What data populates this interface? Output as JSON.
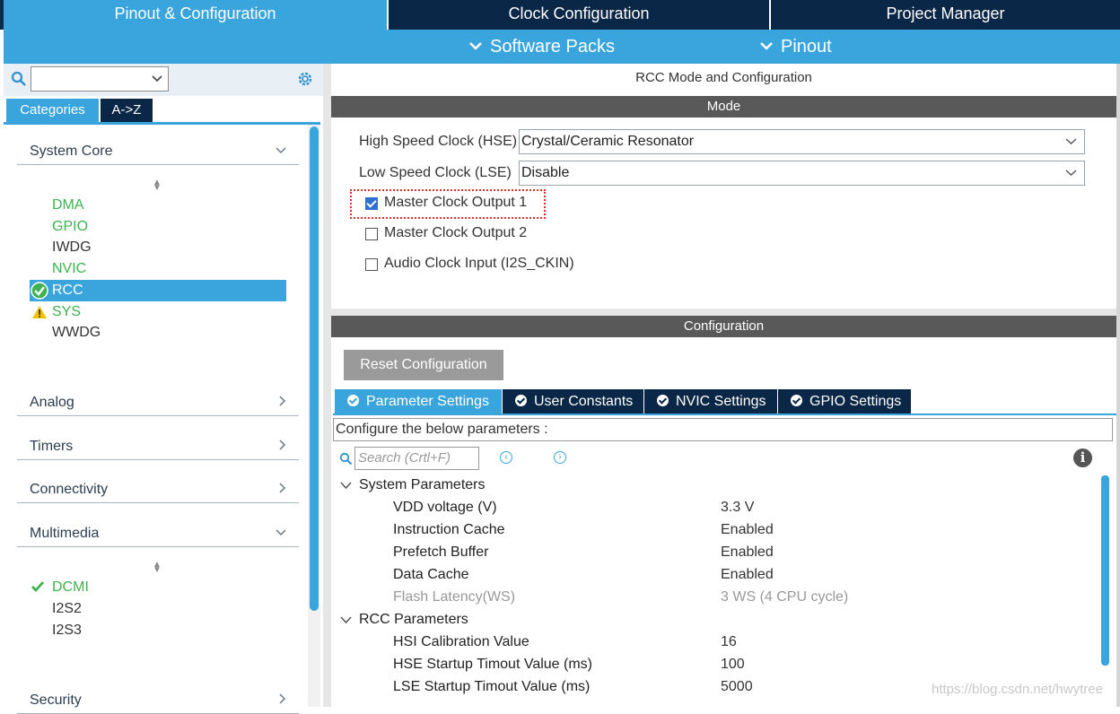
{
  "top_tabs": [
    {
      "label": "Pinout & Configuration",
      "active": true
    },
    {
      "label": "Clock Configuration",
      "active": false
    },
    {
      "label": "Project Manager",
      "active": false
    }
  ],
  "sub_menu": {
    "software_packs": "Software Packs",
    "pinout": "Pinout"
  },
  "left": {
    "category_tabs": [
      "Categories",
      "A->Z"
    ],
    "groups": {
      "system_core": "System Core",
      "analog": "Analog",
      "timers": "Timers",
      "connectivity": "Connectivity",
      "multimedia": "Multimedia",
      "security": "Security"
    },
    "system_core_items": [
      "DMA",
      "GPIO",
      "IWDG",
      "NVIC",
      "RCC",
      "SYS",
      "WWDG"
    ],
    "multimedia_items": [
      "DCMI",
      "I2S2",
      "I2S3"
    ]
  },
  "right": {
    "title": "RCC Mode and Configuration",
    "mode_header": "Mode",
    "hse_label": "High Speed Clock (HSE)",
    "hse_value": "Crystal/Ceramic Resonator",
    "lse_label": "Low Speed Clock (LSE)",
    "lse_value": "Disable",
    "checkboxes": [
      {
        "label": "Master Clock Output 1",
        "checked": true
      },
      {
        "label": "Master Clock Output 2",
        "checked": false
      },
      {
        "label": "Audio Clock Input (I2S_CKIN)",
        "checked": false
      }
    ],
    "config_header": "Configuration",
    "reset_button": "Reset Configuration",
    "param_tabs": [
      "Parameter Settings",
      "User Constants",
      "NVIC Settings",
      "GPIO Settings"
    ],
    "configure_text": "Configure the below parameters :",
    "search_placeholder": "Search (Crtl+F)",
    "system_params_header": "System Parameters",
    "system_params": [
      {
        "name": "VDD voltage (V)",
        "value": "3.3 V"
      },
      {
        "name": "Instruction Cache",
        "value": "Enabled"
      },
      {
        "name": "Prefetch Buffer",
        "value": "Enabled"
      },
      {
        "name": "Data Cache",
        "value": "Enabled"
      },
      {
        "name": "Flash Latency(WS)",
        "value": "3 WS (4 CPU cycle)"
      }
    ],
    "rcc_params_header": "RCC Parameters",
    "rcc_params": [
      {
        "name": "HSI Calibration Value",
        "value": "16"
      },
      {
        "name": "HSE Startup Timout Value (ms)",
        "value": "100"
      },
      {
        "name": "LSE Startup Timout Value (ms)",
        "value": "5000"
      }
    ]
  },
  "watermark": "https://blog.csdn.net/hwytree",
  "colors": {
    "accent": "#3aa4dc",
    "navy": "#0b2747",
    "ok_green": "#3eb151",
    "warn_yellow": "#f2c200"
  }
}
